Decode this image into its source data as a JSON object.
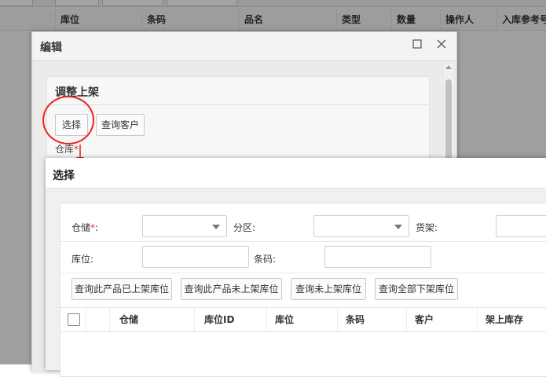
{
  "background_table": {
    "headers": [
      "库位",
      "条码",
      "品名",
      "类型",
      "数量",
      "操作人",
      "入库参考号"
    ]
  },
  "edit_dialog": {
    "title": "编辑",
    "maximize_icon": "maximize-icon",
    "close_icon": "close-icon",
    "panel_title": "调整上架",
    "select_button": "选择",
    "query_customer_button": "查询客户",
    "warehouse_label": "仓库",
    "required_mark": "*"
  },
  "select_dialog": {
    "title": "选择",
    "form": {
      "warehouse_label": "仓储",
      "required_mark": "*",
      "warehouse_colon": ":",
      "zone_label": "分区:",
      "shelf_label": "货架:",
      "location_label": "库位:",
      "barcode_label": "条码:"
    },
    "buttons": [
      "查询此产品已上架库位",
      "查询此产品未上架库位",
      "查询未上架库位",
      "查询全部下架库位"
    ],
    "grid_columns": [
      "仓储",
      "库位ID",
      "库位",
      "条码",
      "客户",
      "架上库存"
    ]
  },
  "colors": {
    "annotation_red": "#e22222",
    "required_red": "#e33333"
  }
}
